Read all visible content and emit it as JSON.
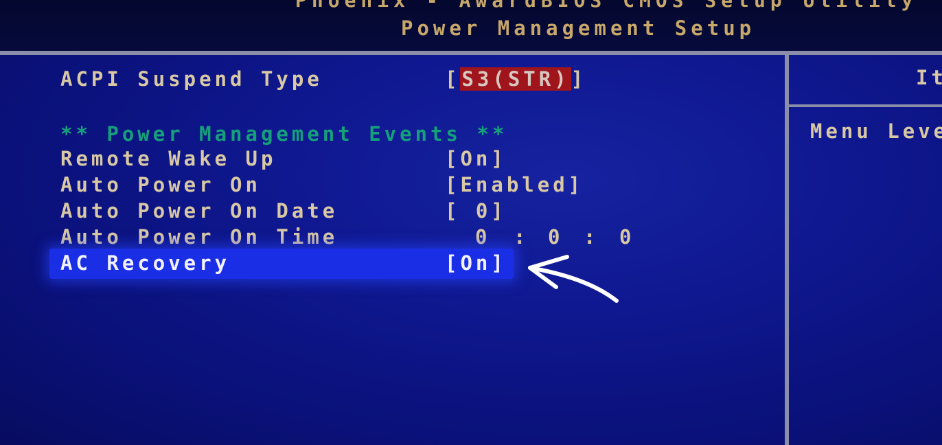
{
  "header": {
    "title_line1": "Phoenix - AwardBIOS CMOS Setup Utility",
    "title_line2": "Power Management Setup"
  },
  "settings": {
    "acpi_suspend": {
      "label": "ACPI Suspend Type",
      "bracket_open": "[",
      "value": "S3(STR)",
      "bracket_close": "]"
    },
    "section_header": "** Power Management Events **",
    "remote_wake": {
      "label": "Remote Wake Up",
      "value": "[On]"
    },
    "auto_power_on": {
      "label": "Auto Power On",
      "value": "[Enabled]"
    },
    "auto_power_on_date": {
      "label": "Auto Power On Date",
      "value": "[ 0]"
    },
    "auto_power_on_time": {
      "label": "Auto Power On Time",
      "hour": "0",
      "sep1": ":",
      "minute": "0",
      "sep2": ":",
      "second": "0"
    },
    "ac_recovery": {
      "label": "AC Recovery",
      "value": "[On]"
    }
  },
  "help_panel": {
    "title": "It",
    "menu_level": "Menu Leve"
  },
  "colors": {
    "background": "#0f1890",
    "label_text": "#d8c8a4",
    "section_text": "#14a07a",
    "highlight": "#1a2ee6",
    "selected_value_bg": "#a0141c",
    "frame": "#8b8ea8"
  },
  "icons": {
    "annotation_arrow": "arrow-pointer-icon"
  }
}
